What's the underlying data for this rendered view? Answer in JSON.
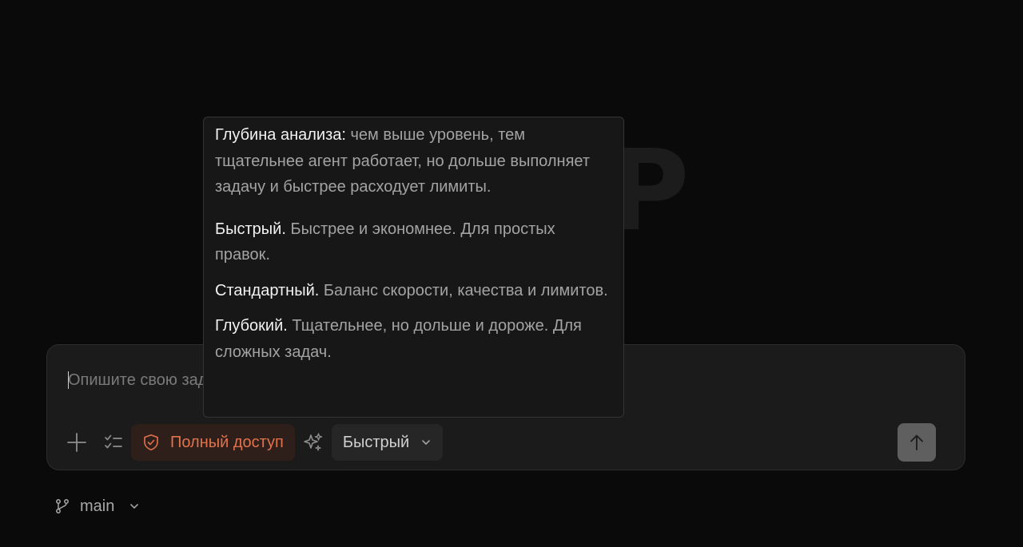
{
  "background_logo": "P",
  "composer": {
    "placeholder": "Опишите свою задачу",
    "access_button_label": "Полный доступ",
    "mode_button_label": "Быстрый"
  },
  "branch": {
    "name": "main"
  },
  "tooltip": {
    "intro_title": "Глубина анализа:",
    "intro_text": " чем выше уровень, тем тщательнее агент работает, но дольше выполняет задачу и быстрее расходует лимиты.",
    "options": [
      {
        "title": "Быстрый.",
        "text": " Быстрее и экономнее. Для простых правок."
      },
      {
        "title": "Стандартный.",
        "text": " Баланс скорости, качества и лимитов."
      },
      {
        "title": "Глубокий.",
        "text": " Тщательнее, но дольше и дороже. Для сложных задач."
      }
    ]
  },
  "icons": {
    "plus": "plus-icon",
    "tasks": "checklist-icon",
    "access": "shield-check-icon",
    "sparkle": "sparkles-icon",
    "mode_chevron": "chevron-down-icon",
    "send": "arrow-up-icon",
    "branch": "git-branch-icon"
  },
  "colors": {
    "accent_orange": "#e2724c",
    "background": "#0a0a0a",
    "composer_bg": "#1b1b1b"
  }
}
